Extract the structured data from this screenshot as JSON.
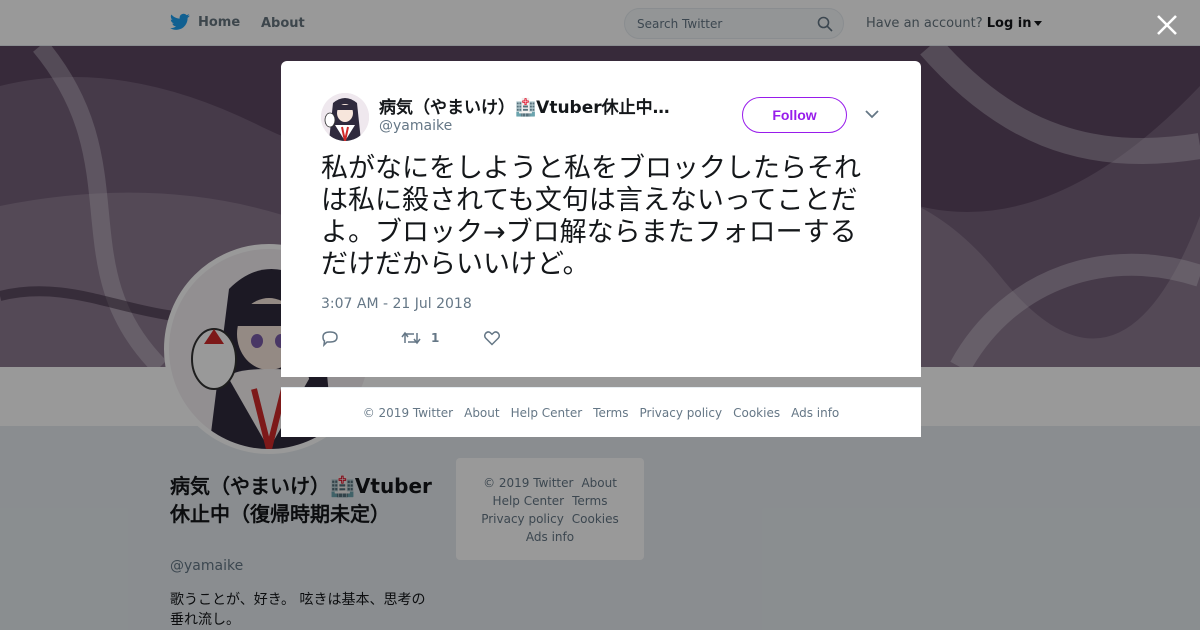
{
  "topbar": {
    "home_label": "Home",
    "about_label": "About",
    "search_placeholder": "Search Twitter",
    "account_prompt": "Have an account?",
    "login_label": "Log in"
  },
  "profile": {
    "name": "病気（やまいけ）🏥Vtuber休止中（復帰時期未定）",
    "handle": "@yamaike",
    "bio": "歌うことが、好き。 呟きは基本、思考の垂れ流し。"
  },
  "side_footer": {
    "copyright": "© 2019 Twitter",
    "about": "About",
    "help": "Help Center",
    "terms": "Terms",
    "privacy": "Privacy policy",
    "cookies": "Cookies",
    "ads": "Ads info"
  },
  "tweet": {
    "author_name": "病気（やまいけ）🏥Vtuber休止中（復帰時期未定）",
    "author_handle": "@yamaike",
    "follow_label": "Follow",
    "text": "私がなにをしようと私をブロックしたらそれは私に殺されても文句は言えないってことだよ。ブロック→ブロ解ならまたフォローするだけだからいいけど。",
    "timestamp": "3:07 AM - 21 Jul 2018",
    "retweet_count": "1"
  },
  "modal_footer": {
    "copyright": "© 2019 Twitter",
    "about": "About",
    "help": "Help Center",
    "terms": "Terms",
    "privacy": "Privacy policy",
    "cookies": "Cookies",
    "ads": "Ads info"
  },
  "colors": {
    "twitter_blue": "#1da1f2",
    "follow_accent": "#981ceb",
    "muted_text": "#657786"
  }
}
